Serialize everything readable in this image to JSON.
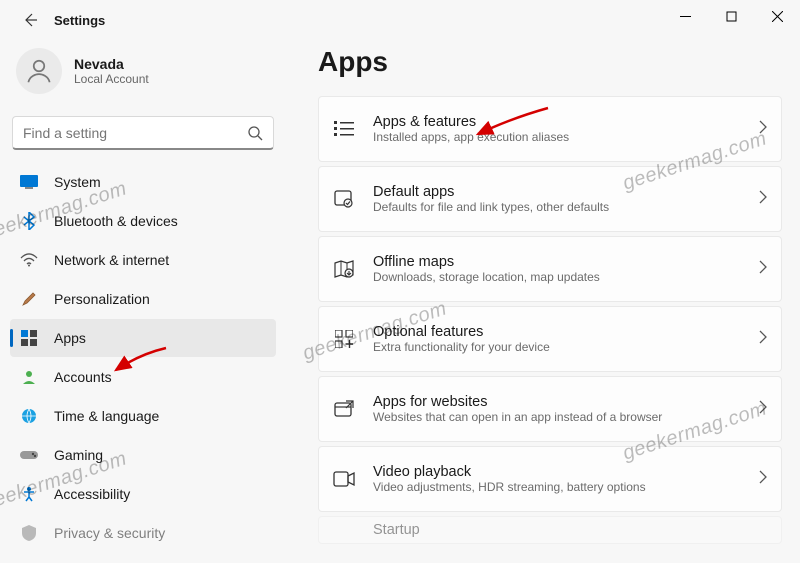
{
  "window": {
    "title": "Settings"
  },
  "profile": {
    "name": "Nevada",
    "desc": "Local Account"
  },
  "search": {
    "placeholder": "Find a setting"
  },
  "nav": {
    "items": [
      {
        "label": "System"
      },
      {
        "label": "Bluetooth & devices"
      },
      {
        "label": "Network & internet"
      },
      {
        "label": "Personalization"
      },
      {
        "label": "Apps"
      },
      {
        "label": "Accounts"
      },
      {
        "label": "Time & language"
      },
      {
        "label": "Gaming"
      },
      {
        "label": "Accessibility"
      },
      {
        "label": "Privacy & security"
      }
    ]
  },
  "page": {
    "title": "Apps"
  },
  "cards": [
    {
      "title": "Apps & features",
      "desc": "Installed apps, app execution aliases"
    },
    {
      "title": "Default apps",
      "desc": "Defaults for file and link types, other defaults"
    },
    {
      "title": "Offline maps",
      "desc": "Downloads, storage location, map updates"
    },
    {
      "title": "Optional features",
      "desc": "Extra functionality for your device"
    },
    {
      "title": "Apps for websites",
      "desc": "Websites that can open in an app instead of a browser"
    },
    {
      "title": "Video playback",
      "desc": "Video adjustments, HDR streaming, battery options"
    },
    {
      "title": "Startup",
      "desc": ""
    }
  ],
  "watermark": "geekermag.com"
}
